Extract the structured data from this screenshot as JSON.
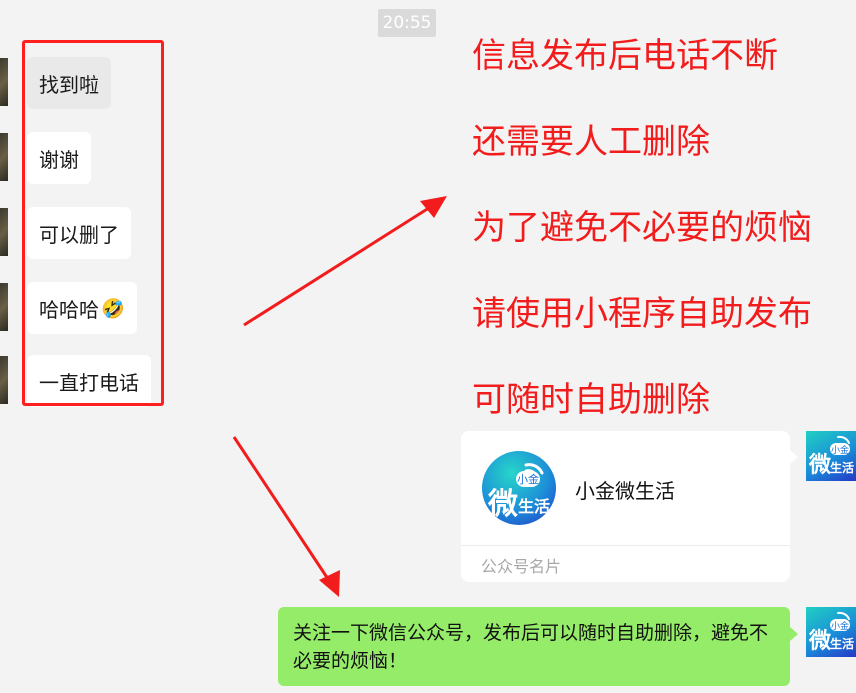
{
  "timestamp": "20:55",
  "incoming_messages": [
    {
      "text": "找到啦"
    },
    {
      "text": "谢谢"
    },
    {
      "text": "可以删了"
    },
    {
      "text": "哈哈哈",
      "emoji": "🤣"
    },
    {
      "text": "一直打电话"
    }
  ],
  "overlay_lines": [
    "信息发布后电话不断",
    "还需要人工删除",
    "为了避免不必要的烦恼",
    "请使用小程序自助发布",
    "可随时自助删除"
  ],
  "contact_card": {
    "logo_top": "小金",
    "logo_main": "微",
    "logo_sub": "生活",
    "name": "小金微生活",
    "footer": "公众号名片"
  },
  "outgoing_message": "关注一下微信公众号，发布后可以随时自助删除，避免不必要的烦恼！",
  "colors": {
    "annotation_red": "#f21c1c",
    "outgoing_bubble": "#95ec69",
    "background": "#f3f3f3"
  }
}
